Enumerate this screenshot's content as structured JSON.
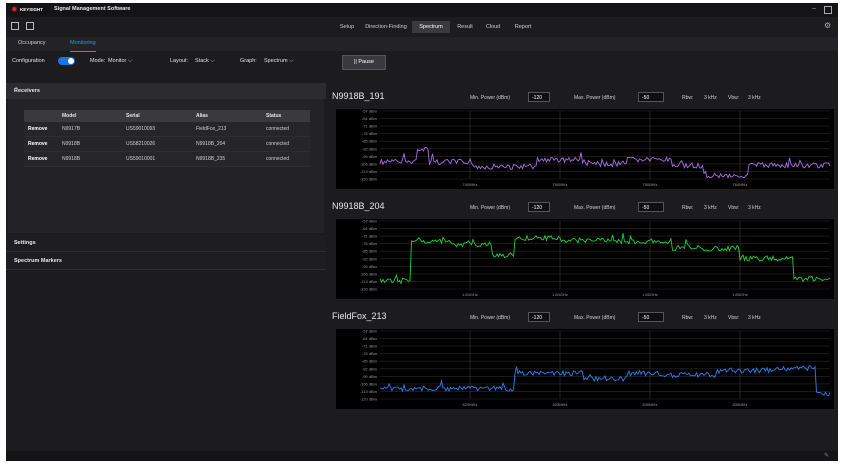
{
  "app": {
    "logo_text": "KEYSIGHT",
    "title": "Signal Management Software"
  },
  "menu": {
    "tabs": [
      "Setup",
      "Direction-Finding",
      "Spectrum",
      "Result",
      "Cloud",
      "Report"
    ],
    "active": "Spectrum"
  },
  "subtabs": {
    "items": [
      "Occupancy",
      "Monitoring"
    ],
    "active": "Monitoring"
  },
  "toolbar": {
    "configuration_label": "Configuration",
    "configuration_on": true,
    "mode_label": "Mode:",
    "mode_value": "Monitor",
    "layout_label": "Layout:",
    "layout_value": "Stack",
    "graph_label": "Graph:",
    "graph_value": "Spectrum",
    "pause_label": "|| Pause"
  },
  "receivers": {
    "title": "Receivers",
    "columns": [
      "",
      "Model",
      "Serial",
      "Alias",
      "Status"
    ],
    "rows": [
      {
        "action": "Remove",
        "model": "N9917B",
        "serial": "US59010093",
        "alias": "FieldFox_213",
        "status": "connected"
      },
      {
        "action": "Remove",
        "model": "N9918B",
        "serial": "US58210026",
        "alias": "N9918B_204",
        "status": "connected"
      },
      {
        "action": "Remove",
        "model": "N9918B",
        "serial": "US59010001",
        "alias": "N9918B_235",
        "status": "connected"
      }
    ]
  },
  "sections": {
    "settings": "Settings",
    "markers": "Spectrum Markers"
  },
  "plots": [
    {
      "title": "N9918B_191",
      "min_power_label": "Min. Power (dBm)",
      "min_power": "-120",
      "max_power_label": "Max. Power (dBm)",
      "max_power": "-50",
      "rbw_label": "Rbw:",
      "rbw": "3 kHz",
      "vbw_label": "Vbw:",
      "vbw": "3 kHz",
      "color": "#a86ee0",
      "y_ticks": [
        "-57 dBm",
        "-64 dBm",
        "-71 dBm",
        "-78 dBm",
        "-85 dBm",
        "-92 dBm",
        "-99 dBm",
        "-106 dBm",
        "-113 dBm",
        "-120 dBm"
      ],
      "x_ticks": [
        "740MHz",
        "750MHz",
        "750MHz",
        "760MHz"
      ]
    },
    {
      "title": "N9918B_204",
      "min_power_label": "Min. Power (dBm)",
      "min_power": "-120",
      "max_power_label": "Max. Power (dBm)",
      "max_power": "-50",
      "rbw_label": "Rbw:",
      "rbw": "3 kHz",
      "vbw_label": "Vbw:",
      "vbw": "3 kHz",
      "color": "#1ed23a",
      "y_ticks": [
        "-57 dBm",
        "-64 dBm",
        "-71 dBm",
        "-78 dBm",
        "-85 dBm",
        "-92 dBm",
        "-99 dBm",
        "-106 dBm",
        "-113 dBm",
        "-120 dBm"
      ],
      "x_ticks": [
        "1.84GHz",
        "1.84GHz",
        "1.85GHz",
        "1.85GHz"
      ]
    },
    {
      "title": "FieldFox_213",
      "min_power_label": "Min. Power (dBm)",
      "min_power": "-120",
      "max_power_label": "Max. Power (dBm)",
      "max_power": "-50",
      "rbw_label": "Rbw:",
      "rbw": "3 kHz",
      "vbw_label": "Vbw:",
      "vbw": "3 kHz",
      "color": "#2e7ff0",
      "y_ticks": [
        "-57 dBm",
        "-64 dBm",
        "-71 dBm",
        "-78 dBm",
        "-85 dBm",
        "-92 dBm",
        "-99 dBm",
        "-106 dBm",
        "-113 dBm",
        "-120 dBm"
      ],
      "x_ticks": [
        "820MHz",
        "825MHz",
        "830MHz",
        "835MHz"
      ]
    }
  ]
}
